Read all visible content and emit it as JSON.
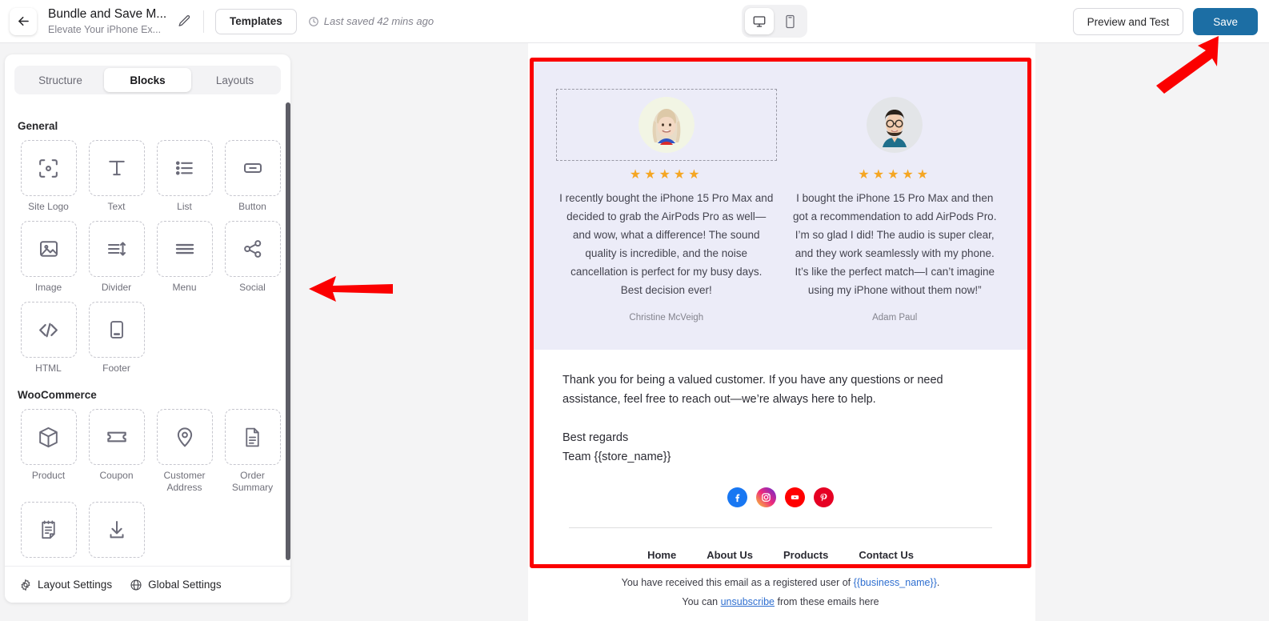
{
  "header": {
    "back_icon": "arrow-left-icon",
    "title": "Bundle and Save M...",
    "subtitle": "Elevate Your iPhone Ex...",
    "edit_icon": "pencil-icon",
    "templates_label": "Templates",
    "clock_icon": "clock-icon",
    "saved_status": "Last saved 42 mins ago",
    "device_desktop_icon": "desktop-icon",
    "device_mobile_icon": "mobile-icon",
    "preview_label": "Preview and Test",
    "save_label": "Save",
    "save_color": "#1c6ea4"
  },
  "sidebar": {
    "tabs": [
      {
        "label": "Structure",
        "active": false
      },
      {
        "label": "Blocks",
        "active": true
      },
      {
        "label": "Layouts",
        "active": false
      }
    ],
    "groups": [
      {
        "title": "General",
        "blocks": [
          {
            "label": "Site Logo",
            "icon": "site-logo-icon"
          },
          {
            "label": "Text",
            "icon": "text-icon"
          },
          {
            "label": "List",
            "icon": "list-icon"
          },
          {
            "label": "Button",
            "icon": "button-icon"
          },
          {
            "label": "Image",
            "icon": "image-icon"
          },
          {
            "label": "Divider",
            "icon": "divider-icon"
          },
          {
            "label": "Menu",
            "icon": "menu-icon"
          },
          {
            "label": "Social",
            "icon": "social-share-icon"
          },
          {
            "label": "HTML",
            "icon": "code-icon"
          },
          {
            "label": "Footer",
            "icon": "footer-icon"
          }
        ]
      },
      {
        "title": "WooCommerce",
        "blocks": [
          {
            "label": "Product",
            "icon": "box-icon"
          },
          {
            "label": "Coupon",
            "icon": "ticket-icon"
          },
          {
            "label": "Customer Address",
            "icon": "map-pin-icon"
          },
          {
            "label": "Order Summary",
            "icon": "document-list-icon"
          },
          {
            "label": "",
            "icon": "note-icon"
          },
          {
            "label": "",
            "icon": "download-icon"
          }
        ]
      }
    ],
    "footer": {
      "layout_settings_label": "Layout Settings",
      "layout_settings_icon": "gear-icon",
      "global_settings_label": "Global Settings",
      "global_settings_icon": "globe-icon"
    }
  },
  "email": {
    "testimonial_bg": "#ececeff",
    "testimonials": [
      {
        "selected": true,
        "avatar": "woman-blonde-avatar",
        "stars": 5,
        "stars_glyphs": "★★★★★",
        "quote": "I recently bought the iPhone 15 Pro Max and decided to grab the AirPods Pro as well—and wow, what a difference! The sound quality is incredible, and the noise cancellation is perfect for my busy days. Best decision ever!",
        "author": "Christine McVeigh"
      },
      {
        "selected": false,
        "avatar": "man-glasses-avatar",
        "stars": 5,
        "stars_glyphs": "★★★★★",
        "quote": "I bought the iPhone 15 Pro Max and then got a recommendation to add AirPods Pro. I’m so glad I did! The audio is super clear, and they work seamlessly with my phone. It’s like the perfect match—I can’t imagine using my iPhone without them now!”",
        "author": "Adam Paul"
      }
    ],
    "closing_paragraph": "Thank you for being a valued customer. If you have any questions or need assistance, feel free to reach out—we’re always here to help.",
    "signoff_line1": "Best regards",
    "signoff_line2": "Team {{store_name}}",
    "social": [
      {
        "name": "facebook-icon",
        "color": "#1877f2",
        "glyph": "f"
      },
      {
        "name": "instagram-icon",
        "color": "#e1306c",
        "glyph": "◙"
      },
      {
        "name": "youtube-icon",
        "color": "#ff0000",
        "glyph": "▶"
      },
      {
        "name": "pinterest-icon",
        "color": "#e60023",
        "glyph": "P"
      }
    ],
    "footer_nav": [
      "Home",
      "About Us",
      "Products",
      "Contact Us"
    ],
    "disclaimer_prefix": "You have received this email as a registered user of ",
    "disclaimer_business": "{{business_name}}",
    "disclaimer_suffix": ".",
    "unsub_prefix": "You can ",
    "unsub_link": "unsubscribe",
    "unsub_suffix": " from these emails here"
  },
  "annotations": {
    "arrow_color": "#fb0000",
    "highlight_border_color": "#fb0000",
    "arrow_left_target": "blocks-panel",
    "arrow_up_right_target": "save-button"
  }
}
